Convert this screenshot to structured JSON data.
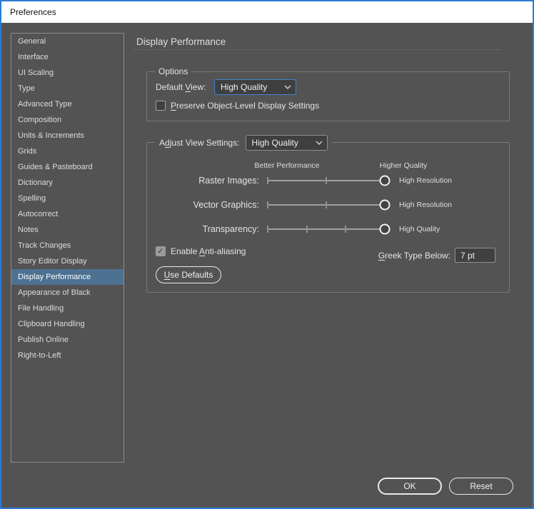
{
  "window": {
    "title": "Preferences",
    "accent_border_color": "#2b7cd3",
    "selected_item_color": "#4d7191"
  },
  "sidebar": {
    "items": [
      {
        "label": "General",
        "selected": false
      },
      {
        "label": "Interface",
        "selected": false
      },
      {
        "label": "UI Scaling",
        "selected": false
      },
      {
        "label": "Type",
        "selected": false
      },
      {
        "label": "Advanced Type",
        "selected": false
      },
      {
        "label": "Composition",
        "selected": false
      },
      {
        "label": "Units & Increments",
        "selected": false
      },
      {
        "label": "Grids",
        "selected": false
      },
      {
        "label": "Guides & Pasteboard",
        "selected": false
      },
      {
        "label": "Dictionary",
        "selected": false
      },
      {
        "label": "Spelling",
        "selected": false
      },
      {
        "label": "Autocorrect",
        "selected": false
      },
      {
        "label": "Notes",
        "selected": false
      },
      {
        "label": "Track Changes",
        "selected": false
      },
      {
        "label": "Story Editor Display",
        "selected": false
      },
      {
        "label": "Display Performance",
        "selected": true
      },
      {
        "label": "Appearance of Black",
        "selected": false
      },
      {
        "label": "File Handling",
        "selected": false
      },
      {
        "label": "Clipboard Handling",
        "selected": false
      },
      {
        "label": "Publish Online",
        "selected": false
      },
      {
        "label": "Right-to-Left",
        "selected": false
      }
    ]
  },
  "content": {
    "heading": "Display Performance",
    "options_group": {
      "legend": "Options",
      "default_view_label": {
        "pre": "Default ",
        "mn": "V",
        "post": "iew:"
      },
      "default_view_value": "High Quality",
      "preserve_label": {
        "pre": "",
        "mn": "P",
        "post": "reserve Object-Level Display Settings"
      },
      "preserve_checked": false
    },
    "adjust_group": {
      "label": {
        "pre": "A",
        "mn": "d",
        "post": "just View Settings:"
      },
      "value": "High Quality",
      "col_left": "Better Performance",
      "col_right": "Higher Quality",
      "sliders": [
        {
          "label": "Raster Images:",
          "value_label": "High Resolution",
          "ticks": [
            0,
            0.5,
            1
          ],
          "position": 1
        },
        {
          "label": "Vector Graphics:",
          "value_label": "High Resolution",
          "ticks": [
            0,
            0.5,
            1
          ],
          "position": 1
        },
        {
          "label": "Transparency:",
          "value_label": "High Quality",
          "ticks": [
            0,
            0.333,
            0.667,
            1
          ],
          "position": 1
        }
      ],
      "antialias_label": {
        "pre": "Enable ",
        "mn": "A",
        "post": "nti-aliasing"
      },
      "antialias_checked": true,
      "check_glyph": "✓",
      "greek_label": {
        "pre": "",
        "mn": "G",
        "post": "reek Type Below:"
      },
      "greek_value": "7 pt",
      "use_defaults_label": {
        "pre": "",
        "mn": "U",
        "post": "se Defaults"
      }
    },
    "footer": {
      "ok_label": "OK",
      "reset_label": "Reset"
    }
  }
}
